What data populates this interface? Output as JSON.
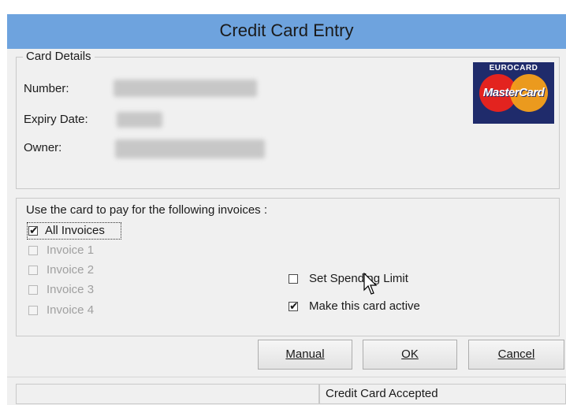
{
  "window": {
    "title": "Credit Card Entry"
  },
  "card_details": {
    "legend": "Card Details",
    "number_label": "Number:",
    "expiry_label": "Expiry Date:",
    "owner_label": "Owner:",
    "logo": {
      "top_text": "EUROCARD",
      "brand_text": "MasterCard"
    }
  },
  "invoices": {
    "prompt": "Use the card to pay for the following invoices :",
    "items": [
      {
        "label": "All Invoices",
        "checked": true,
        "enabled": true
      },
      {
        "label": "Invoice 1",
        "checked": false,
        "enabled": false
      },
      {
        "label": "Invoice 2",
        "checked": false,
        "enabled": false
      },
      {
        "label": "Invoice 3",
        "checked": false,
        "enabled": false
      },
      {
        "label": "Invoice 4",
        "checked": false,
        "enabled": false
      }
    ],
    "set_spending_limit": {
      "label": "Set Spending Limit",
      "checked": false
    },
    "make_active": {
      "label": "Make this card active",
      "checked": true
    }
  },
  "buttons": {
    "manual": "Manual",
    "ok": "OK",
    "cancel": "Cancel"
  },
  "status_bar": {
    "message": "Credit Card Accepted"
  },
  "colors": {
    "title_bar": "#6ea3de",
    "client": "#f0f0f0",
    "logo_navy": "#1f2b6b",
    "mc_red": "#e3231f",
    "mc_yellow": "#f7a01a"
  }
}
